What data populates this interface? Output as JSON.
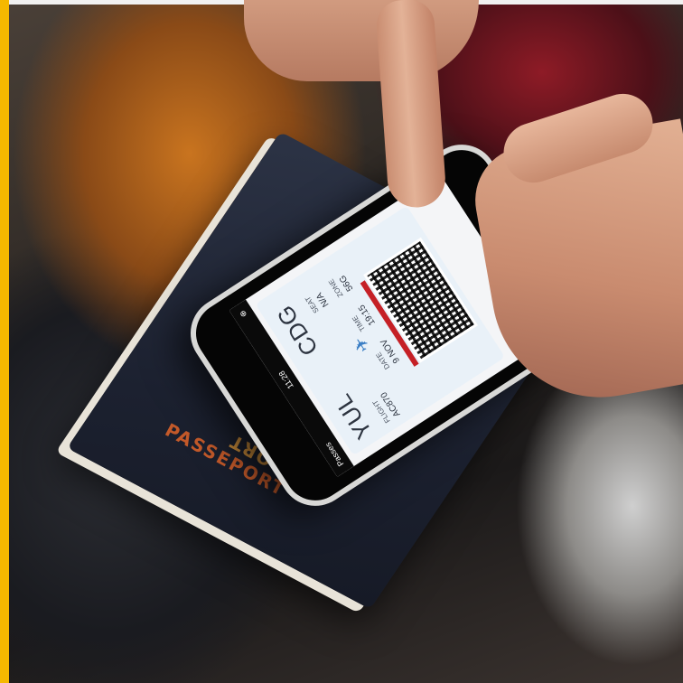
{
  "scene": {
    "description_colors": {
      "accent_bar": "#f5b800",
      "passport_cover": "#1c2130",
      "passport_text": "#c98b3a"
    }
  },
  "passport": {
    "line1": "PASSPORT",
    "line2": "PASSEPORT"
  },
  "phone": {
    "header": {
      "title": "Passes",
      "time": "11:28"
    },
    "pass": {
      "from_code": "YUL",
      "to_code": "CDG",
      "flight_label": "FLIGHT",
      "flight": "AC870",
      "date_label": "DATE",
      "date": "9 NOV",
      "time_label": "TIME",
      "time": "19:15",
      "seat_label": "SEAT",
      "seat": "N/A",
      "group_label": "ZONE",
      "group": "56G",
      "airplane_icon": "plane-icon",
      "add_icon": "plus-circle-icon"
    }
  }
}
